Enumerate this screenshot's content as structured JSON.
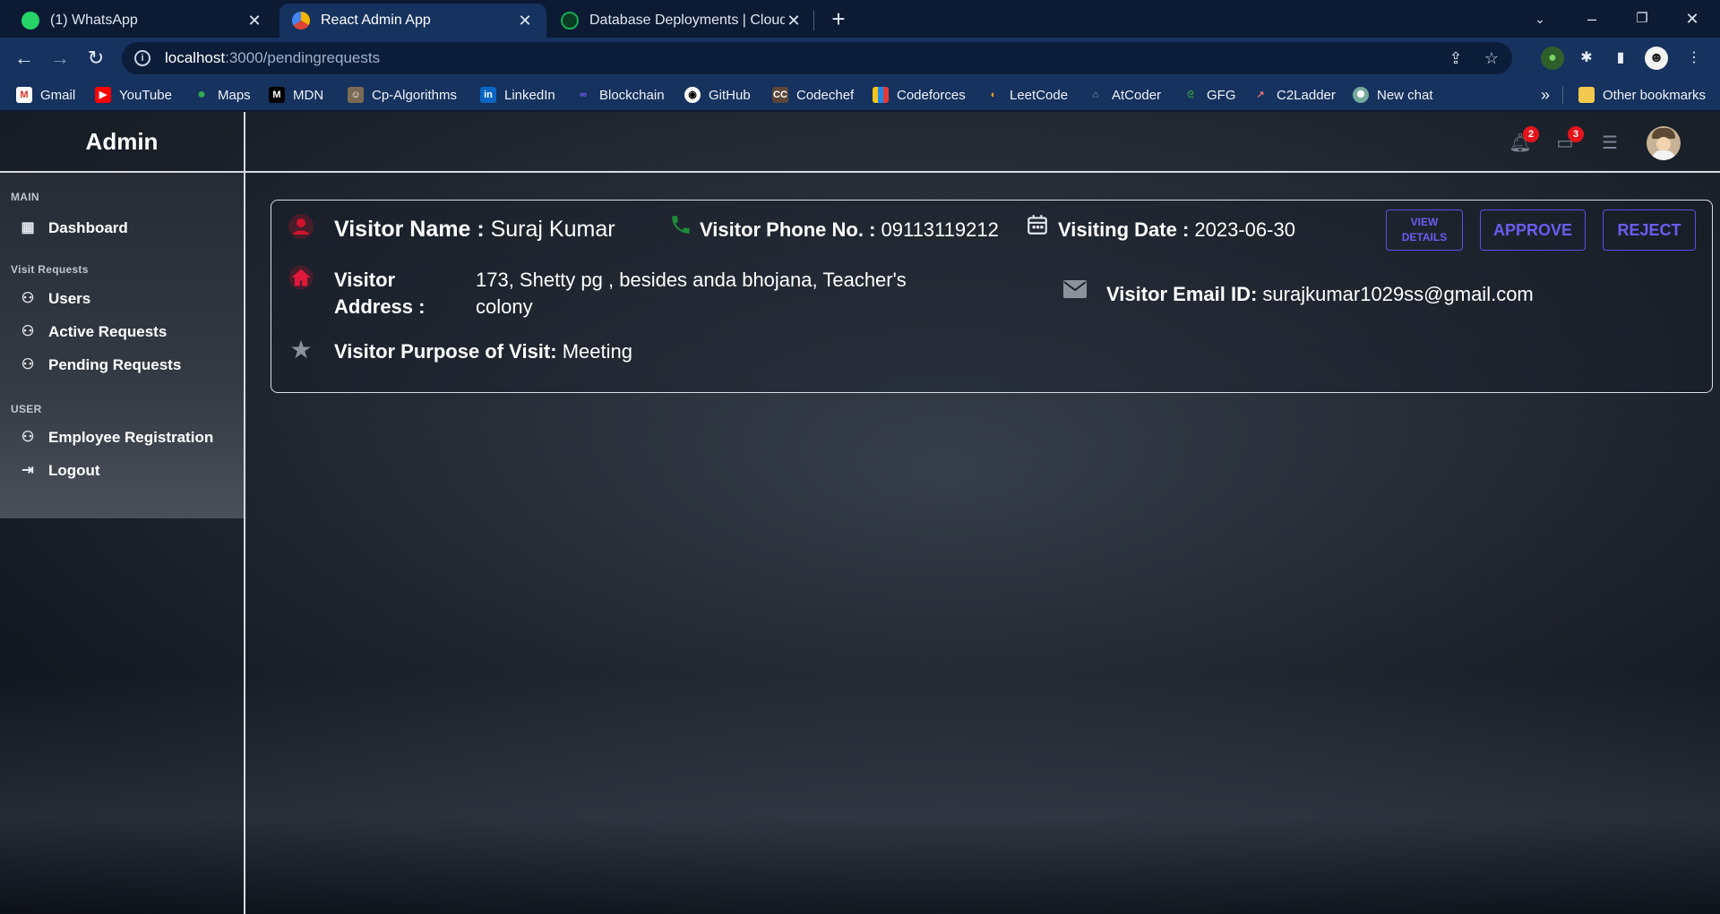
{
  "browser": {
    "tabs": [
      {
        "title": "(1) WhatsApp",
        "active": false
      },
      {
        "title": "React Admin App",
        "active": true
      },
      {
        "title": "Database Deployments | Cloud: M",
        "active": false
      }
    ],
    "url_host": "localhost",
    "url_path": ":3000/pendingrequests",
    "bookmarks": [
      "Gmail",
      "YouTube",
      "Maps",
      "MDN",
      "Cp-Algorithms",
      "LinkedIn",
      "Blockchain",
      "GitHub",
      "Codechef",
      "Codeforces",
      "LeetCode",
      "AtCoder",
      "GFG",
      "C2Ladder",
      "New chat"
    ],
    "other_bookmarks": "Other bookmarks",
    "overflow": "»"
  },
  "sidebar": {
    "brand": "Admin",
    "sections": [
      {
        "title": "MAIN",
        "items": [
          {
            "label": "Dashboard",
            "icon": "dashboard-icon"
          }
        ]
      },
      {
        "title": "Visit Requests",
        "items": [
          {
            "label": "Users",
            "icon": "person-icon"
          },
          {
            "label": "Active Requests",
            "icon": "person-icon"
          },
          {
            "label": "Pending Requests",
            "icon": "person-icon"
          }
        ]
      },
      {
        "title": "USER",
        "items": [
          {
            "label": "Employee Registration",
            "icon": "person-icon"
          },
          {
            "label": "Logout",
            "icon": "logout-icon"
          }
        ]
      }
    ]
  },
  "topbar": {
    "notifications_count": "2",
    "messages_count": "3"
  },
  "request": {
    "name_label": "Visitor Name :",
    "name_value": " Suraj Kumar",
    "phone_label": "Visitor Phone No. :",
    "phone_value": " 09113119212",
    "date_label": "Visiting Date :",
    "date_value": " 2023-06-30",
    "address_label_line1": "Visitor",
    "address_label_line2": "Address :",
    "address_value_line1": "173, Shetty pg , besides anda bhojana, Teacher's",
    "address_value_line2": "colony",
    "email_label": "Visitor Email ID:",
    "email_value": " surajkumar1029ss@gmail.com",
    "purpose_label": "Visitor Purpose of Visit:",
    "purpose_value": " Meeting",
    "view_details_line1": "VIEW",
    "view_details_line2": "DETAILS",
    "approve_label": "APPROVE",
    "reject_label": "REJECT"
  },
  "colors": {
    "accent": "#5e4ee0",
    "icon_red": "#d0142c",
    "icon_green": "#1f8a3b",
    "badge": "#e5141b"
  }
}
